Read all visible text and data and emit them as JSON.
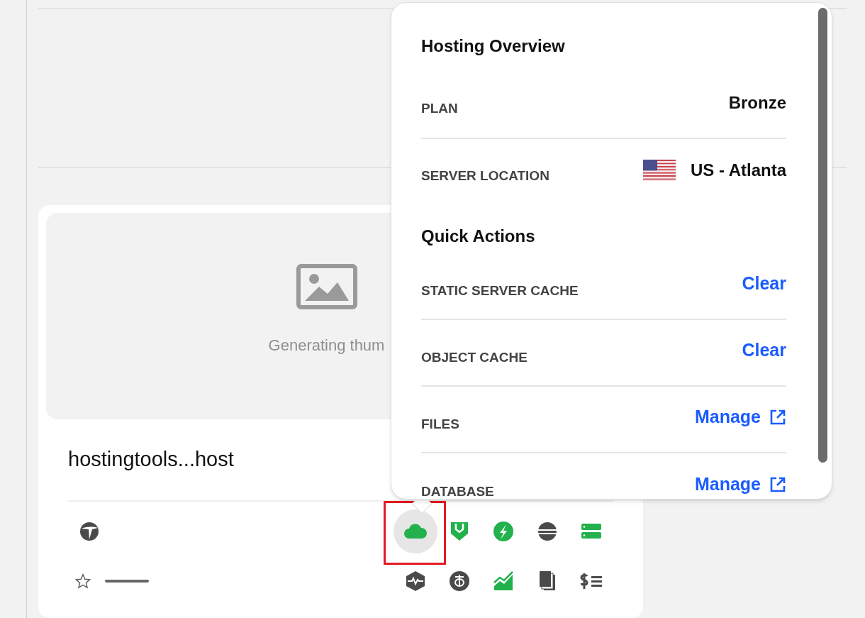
{
  "card": {
    "thumbnail_text": "Generating thum",
    "site_name": "hostingtools...host",
    "favorite": false,
    "left_icon": {
      "kind": "wordpress"
    },
    "tool_icons": [
      {
        "kind": "cloud",
        "selected": true
      },
      {
        "kind": "shield",
        "selected": false
      },
      {
        "kind": "bolt",
        "selected": false
      },
      {
        "kind": "disk",
        "selected": false
      },
      {
        "kind": "server",
        "selected": false
      },
      {
        "kind": "pulse",
        "selected": false
      },
      {
        "kind": "bug",
        "selected": false
      },
      {
        "kind": "chart",
        "selected": false
      },
      {
        "kind": "pages",
        "selected": false
      },
      {
        "kind": "billing",
        "selected": false
      }
    ]
  },
  "popover": {
    "overview": {
      "title": "Hosting Overview",
      "rows": [
        {
          "label": "PLAN",
          "value": "Bronze",
          "flag": false
        },
        {
          "label": "SERVER LOCATION",
          "value": "US - Atlanta",
          "flag": true
        }
      ]
    },
    "quick_actions": {
      "title": "Quick Actions",
      "rows": [
        {
          "label": "STATIC SERVER CACHE",
          "action": "Clear",
          "external": false
        },
        {
          "label": "OBJECT CACHE",
          "action": "Clear",
          "external": false
        },
        {
          "label": "FILES",
          "action": "Manage",
          "external": true
        },
        {
          "label": "DATABASE",
          "action": "Manage",
          "external": true
        }
      ]
    }
  }
}
